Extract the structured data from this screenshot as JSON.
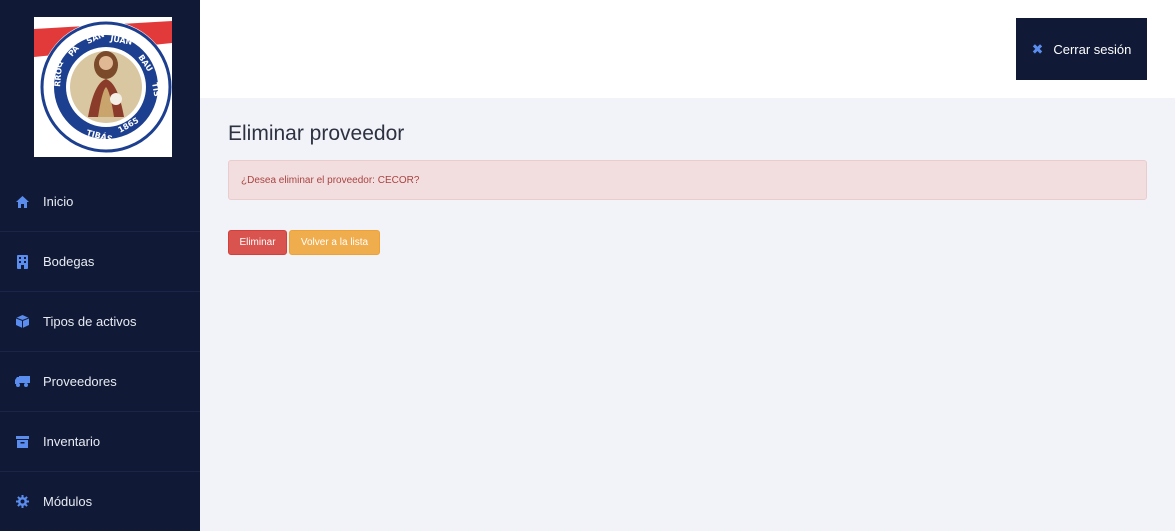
{
  "logo": {
    "seal_text": "PARROQUIA SAN JUAN BAUTISTA TIBÁS, 1865",
    "icon": "parish-seal-logo"
  },
  "sidebar": {
    "items": [
      {
        "label": "Inicio",
        "icon": "home-icon"
      },
      {
        "label": "Bodegas",
        "icon": "building-icon"
      },
      {
        "label": "Tipos de activos",
        "icon": "cube-icon"
      },
      {
        "label": "Proveedores",
        "icon": "truck-icon"
      },
      {
        "label": "Inventario",
        "icon": "archive-icon"
      },
      {
        "label": "Módulos",
        "icon": "gear-icon"
      }
    ]
  },
  "header": {
    "logout_label": "Cerrar sesión",
    "logout_icon": "close-icon"
  },
  "main": {
    "title": "Eliminar proveedor",
    "alert_text": "¿Desea eliminar el proveedor: CECOR?",
    "delete_label": "Eliminar",
    "back_label": "Volver a la lista"
  },
  "colors": {
    "sidebar_bg": "#101a36",
    "danger": "#d9534f",
    "warning": "#f0ad4e",
    "alert_bg": "#f2dede",
    "alert_text": "#a94442",
    "icon_accent": "#5b8dee"
  }
}
